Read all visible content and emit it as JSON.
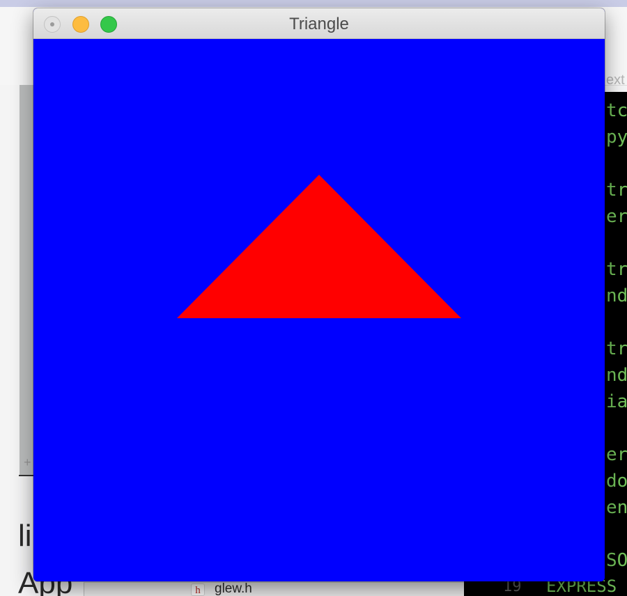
{
  "window": {
    "title": "Triangle",
    "clear_color": "#0000ff",
    "triangle_color": "#ff0000"
  },
  "background": {
    "left_text_1": "li",
    "left_text_2": "App",
    "file_icon_glyph": "h",
    "file_name": "glew.h",
    "header_hint": "ext"
  },
  "terminal": {
    "rows": [
      "tc",
      "py",
      "",
      "tr",
      "er",
      "",
      "tr",
      "nd",
      "",
      "tr",
      "nd",
      "ia",
      "",
      "er",
      "do",
      "en",
      "",
      "SO"
    ],
    "line_number": "19",
    "bottom_text": "EXPRESS"
  }
}
